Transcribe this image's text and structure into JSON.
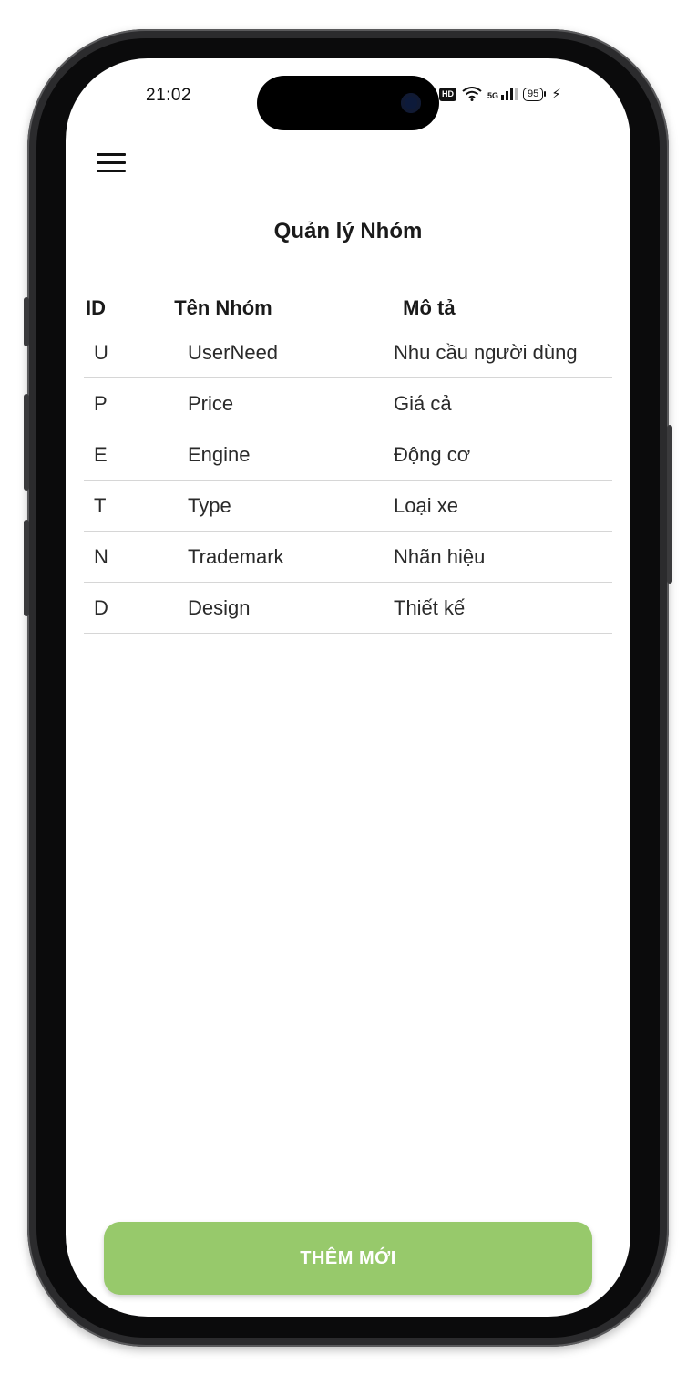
{
  "status_bar": {
    "time": "21:02",
    "hd_label": "HD",
    "network": "5G",
    "battery": "95"
  },
  "header": {
    "menu_icon": "hamburger-menu-icon",
    "title": "Quản lý Nhóm"
  },
  "table": {
    "columns": [
      "ID",
      "Tên Nhóm",
      "Mô tả"
    ],
    "rows": [
      {
        "id": "U",
        "name": "UserNeed",
        "desc": "Nhu cầu người dùng"
      },
      {
        "id": "P",
        "name": "Price",
        "desc": "Giá cả"
      },
      {
        "id": "E",
        "name": "Engine",
        "desc": "Động cơ"
      },
      {
        "id": "T",
        "name": "Type",
        "desc": "Loại xe"
      },
      {
        "id": "N",
        "name": "Trademark",
        "desc": "Nhãn hiệu"
      },
      {
        "id": "D",
        "name": "Design",
        "desc": "Thiết kế"
      }
    ]
  },
  "actions": {
    "add_label": "THÊM MỚI"
  },
  "colors": {
    "accent": "#97c96b",
    "divider": "#d6d6d6",
    "text": "#1a1a1a"
  }
}
